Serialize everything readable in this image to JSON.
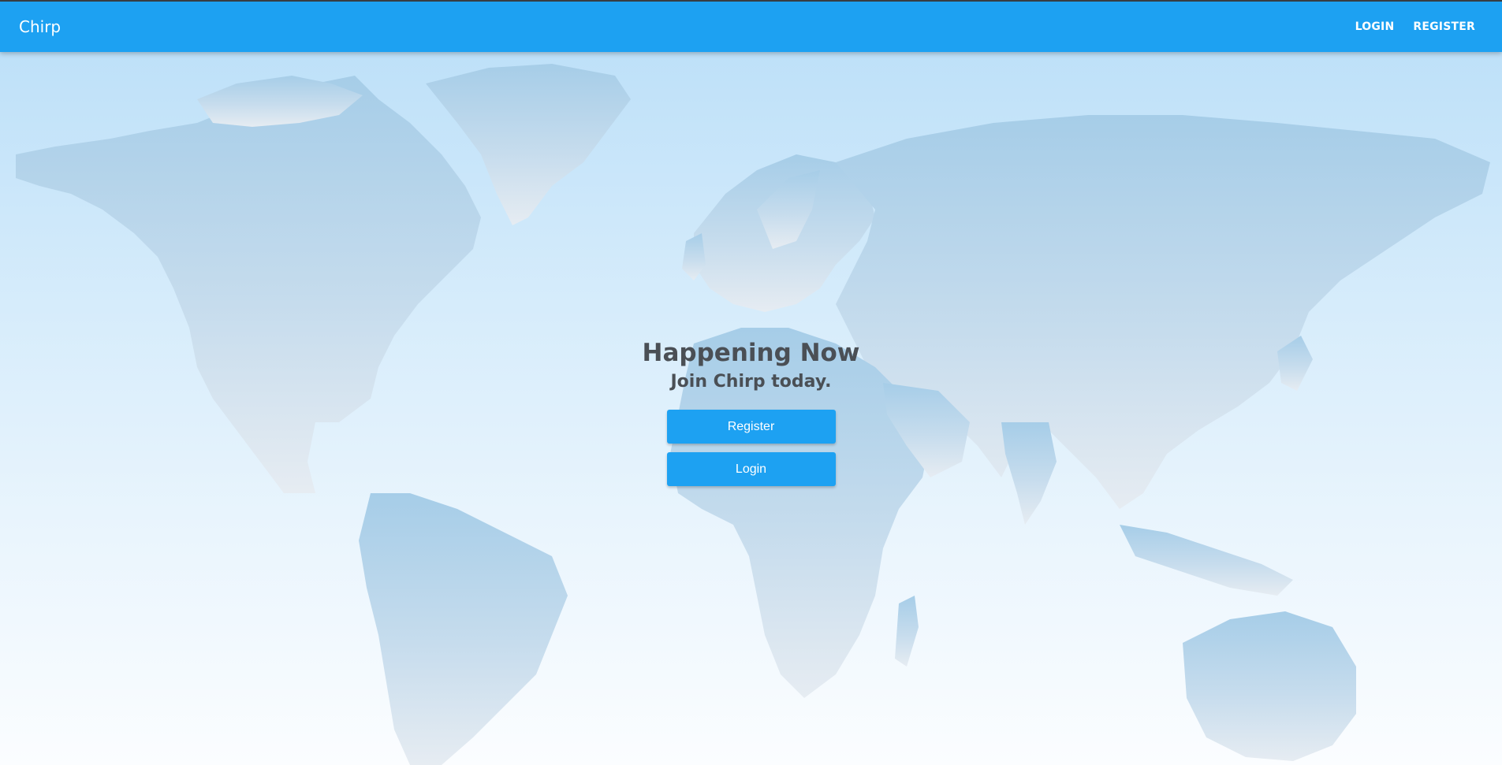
{
  "navbar": {
    "brand": "Chirp",
    "links": [
      {
        "label": "LOGIN"
      },
      {
        "label": "REGISTER"
      }
    ],
    "background_color": "#1da1f2"
  },
  "background": {
    "image": "world-map",
    "gradient_top": "#b9def8",
    "gradient_bottom": "#fbfdff"
  },
  "hero": {
    "title": "Happening Now",
    "subtitle": "Join Chirp today.",
    "buttons": [
      {
        "label": "Register"
      },
      {
        "label": "Login"
      }
    ]
  },
  "colors": {
    "accent": "#1da1f2",
    "heading_text": "#4a4f55",
    "button_text": "#ffffff"
  }
}
